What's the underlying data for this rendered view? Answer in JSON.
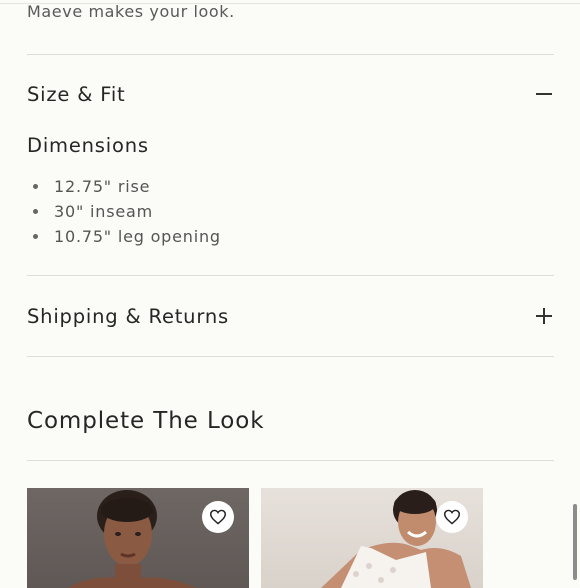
{
  "intro_text": "Maeve makes your look.",
  "size_fit": {
    "title": "Size & Fit",
    "state": "expanded",
    "icon": "minus-icon",
    "dimensions_title": "Dimensions",
    "items": [
      "12.75\" rise",
      "30\" inseam",
      "10.75\" leg opening"
    ]
  },
  "shipping_returns": {
    "title": "Shipping & Returns",
    "state": "collapsed",
    "icon": "plus-icon"
  },
  "complete_the_look": {
    "title": "Complete The Look",
    "products": [
      {
        "image": "model-photo-1",
        "favorite_icon": "heart-icon"
      },
      {
        "image": "model-photo-2",
        "favorite_icon": "heart-icon"
      }
    ]
  },
  "colors": {
    "background": "#fbfbf8",
    "text": "#262626",
    "divider": "#dcdcd8"
  }
}
